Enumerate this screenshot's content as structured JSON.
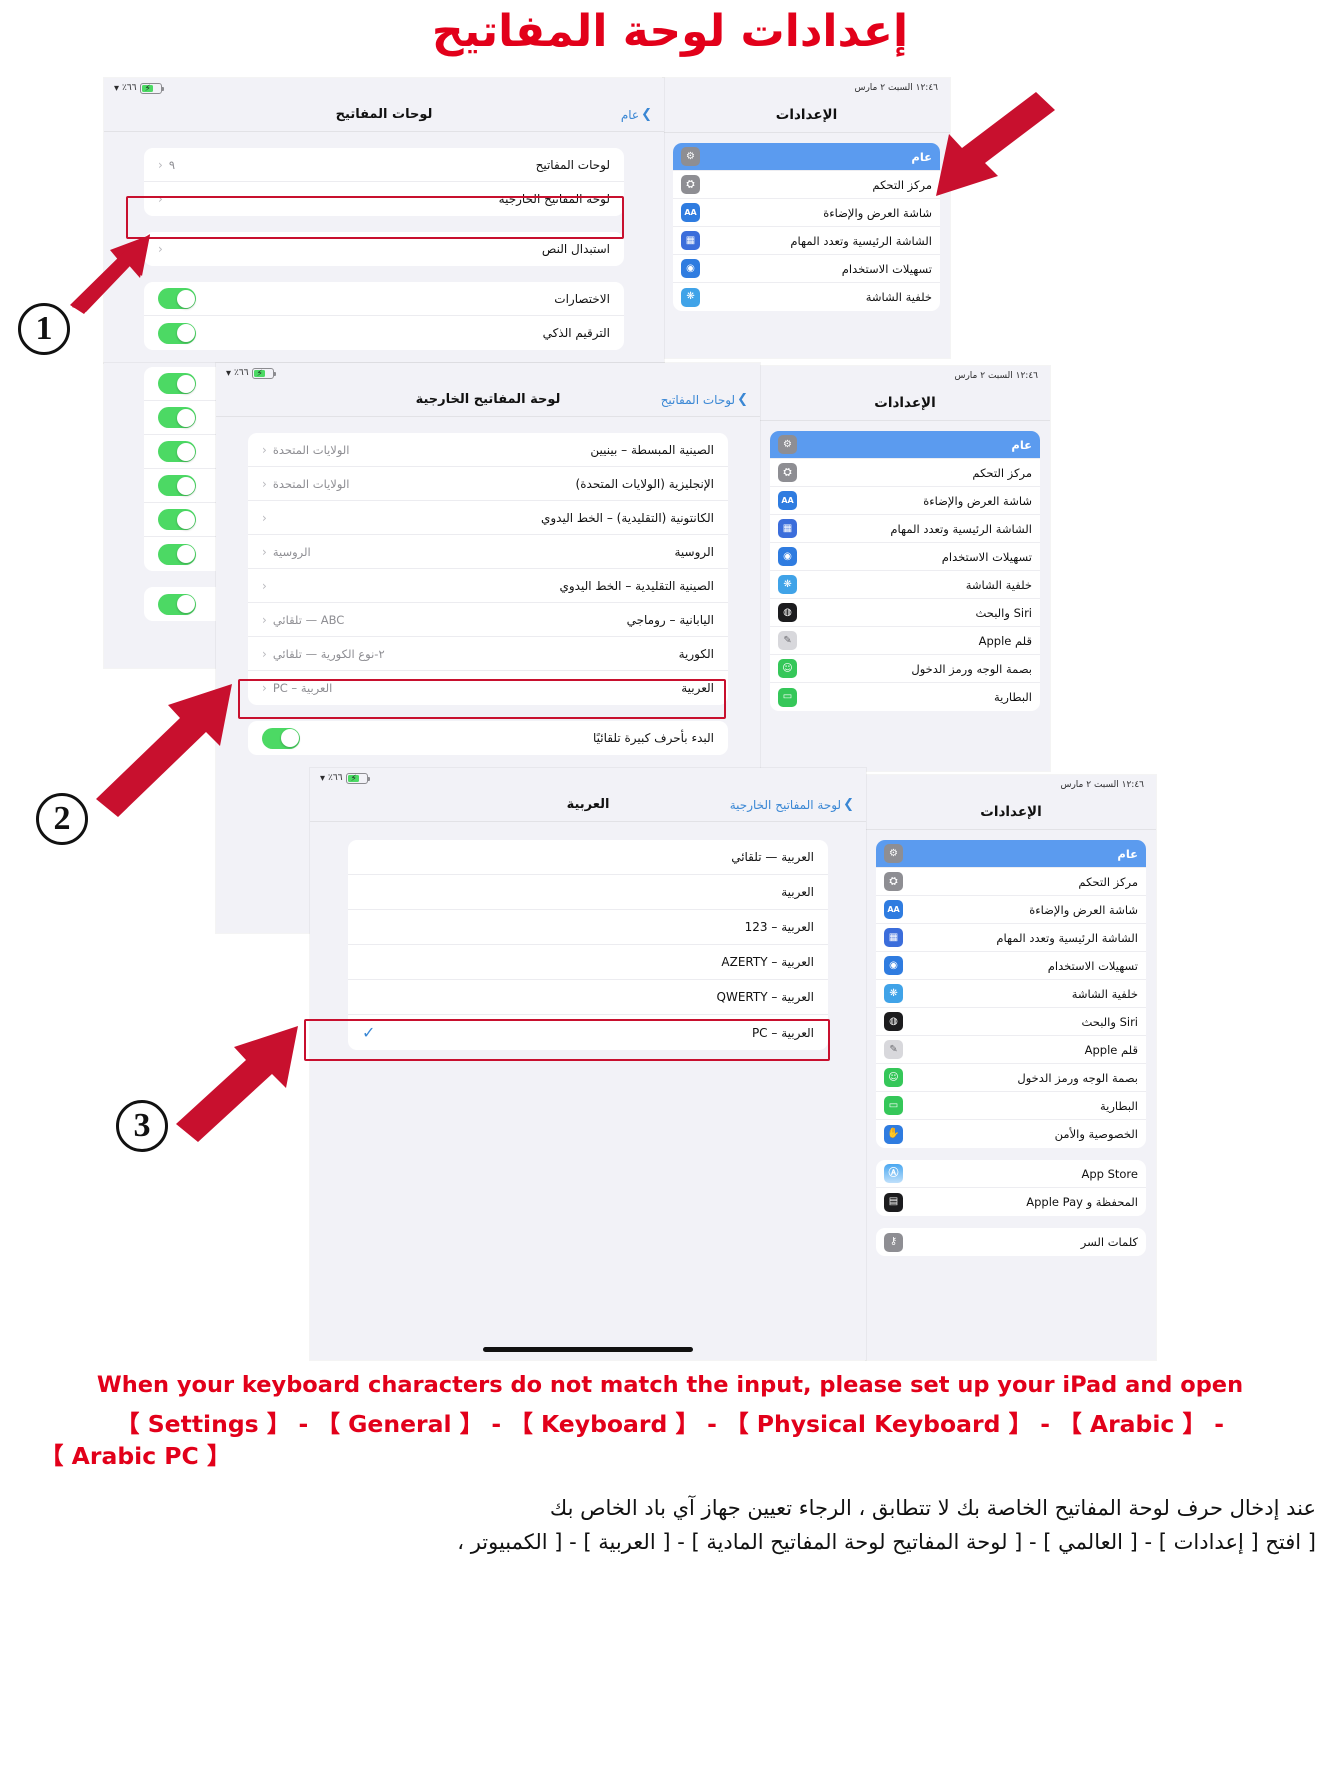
{
  "title": "إعدادات لوحة المفاتيح",
  "status_bar": {
    "battery_pct": "٦٦٪",
    "time_right": "١٢:٤٦   السبت ٢ مارس"
  },
  "panel1": {
    "nav_title": "لوحات المفاتيح",
    "back_label": "عام",
    "rows": [
      {
        "label": "لوحات المفاتيح",
        "value": "٩",
        "chevron": "‹"
      },
      {
        "label": "لوحة المفاتيح الخارجية",
        "value": "",
        "chevron": "‹"
      },
      {
        "label": "استبدال النص",
        "value": "",
        "chevron": "‹"
      }
    ],
    "toggles": [
      {
        "label": "الاختصارات",
        "on": true
      },
      {
        "label": "الترقيم الذكي",
        "on": true
      }
    ]
  },
  "panel2": {
    "nav_title": "لوحة المفاتيح الخارجية",
    "back_label": "لوحات المفاتيح",
    "rows": [
      {
        "label": "الصينية المبسطة – بينيين",
        "value": "الولايات المتحدة"
      },
      {
        "label": "الإنجليزية (الولايات المتحدة)",
        "value": "الولايات المتحدة"
      },
      {
        "label": "الكانتونية (التقليدية) – الخط اليدوي",
        "value": ""
      },
      {
        "label": "الروسية",
        "value": "الروسية"
      },
      {
        "label": "الصينية التقليدية – الخط اليدوي",
        "value": ""
      },
      {
        "label": "اليابانية – روماجي",
        "value": "ABC — تلقائي"
      },
      {
        "label": "الكورية",
        "value": "٢-نوع الكورية — تلقائي"
      },
      {
        "label": "العربية",
        "value": "العربية – PC"
      }
    ],
    "toggle_row": {
      "label": "البدء بأحرف كبيرة تلقائيًا",
      "on": true
    }
  },
  "panel3": {
    "nav_title": "العربية",
    "back_label": "لوحة المفاتيح الخارجية",
    "options": [
      {
        "label": "العربية — تلقائي",
        "checked": false
      },
      {
        "label": "العربية",
        "checked": false
      },
      {
        "label": "العربية – 123",
        "checked": false
      },
      {
        "label": "العربية – AZERTY",
        "checked": false
      },
      {
        "label": "العربية – QWERTY",
        "checked": false
      },
      {
        "label": "العربية – PC",
        "checked": true
      }
    ],
    "check_glyph": "✓"
  },
  "settings_sidebar": {
    "title": "الإعدادات",
    "items": [
      {
        "label": "عام",
        "icon": "gear-icon",
        "glyph": "⚙",
        "color": "#8e8e93",
        "selected": true
      },
      {
        "label": "مركز التحكم",
        "icon": "control-center-icon",
        "glyph": "⛭",
        "color": "#8e8e93",
        "selected": false
      },
      {
        "label": "شاشة العرض والإضاءة",
        "icon": "display-brightness-icon",
        "glyph": "AA",
        "color": "#2f7ce0",
        "selected": false
      },
      {
        "label": "الشاشة الرئيسية وتعدد المهام",
        "icon": "home-screen-icon",
        "glyph": "▦",
        "color": "#3b6ddb",
        "selected": false
      },
      {
        "label": "تسهيلات الاستخدام",
        "icon": "accessibility-icon",
        "glyph": "◉",
        "color": "#2f7ce0",
        "selected": false
      },
      {
        "label": "خلفية الشاشة",
        "icon": "wallpaper-icon",
        "glyph": "❋",
        "color": "#40a3e8",
        "selected": false
      },
      {
        "label": "Siri والبحث",
        "icon": "siri-icon",
        "glyph": "◍",
        "color": "#1c1c1e",
        "selected": false
      },
      {
        "label": "قلم Apple",
        "icon": "apple-pencil-icon",
        "glyph": "✎",
        "color": "#d8d8dc",
        "selected": false
      },
      {
        "label": "بصمة الوجه ورمز الدخول",
        "icon": "face-id-icon",
        "glyph": "☺",
        "color": "#35c759",
        "selected": false
      },
      {
        "label": "البطارية",
        "icon": "battery-icon",
        "glyph": "▭",
        "color": "#35c759",
        "selected": false
      },
      {
        "label": "الخصوصية والأمن",
        "icon": "privacy-hand-icon",
        "glyph": "✋",
        "color": "#2f7ce0",
        "selected": false
      }
    ],
    "group2": [
      {
        "label": "App Store",
        "icon": "app-store-icon",
        "glyph": "Ⓐ",
        "color": "#4aa8f0"
      },
      {
        "label": "المحفظة و Apple Pay",
        "icon": "wallet-icon",
        "glyph": "▤",
        "color": "#1c1c1e"
      }
    ],
    "group3": [
      {
        "label": "كلمات السر",
        "icon": "passwords-key-icon",
        "glyph": "🔑",
        "color": "#8e8e93"
      }
    ]
  },
  "steps": {
    "one": "1",
    "two": "2",
    "three": "3"
  },
  "caption_en_line1": "When your keyboard characters do not match the input, please set up your iPad and open",
  "caption_en_line2": "【 Settings 】 - 【 General 】 - 【 Keyboard 】 - 【 Physical Keyboard 】 - 【 Arabic 】 -",
  "caption_en_line3": "【 Arabic PC 】",
  "caption_ar_line1": "عند إدخال حرف لوحة المفاتيح الخاصة بك لا تتطابق ، الرجاء تعيين جهاز آي باد الخاص بك",
  "caption_ar_line2": "[ افتح [ إعدادات ] - [ العالمي ] - [ لوحة المفاتيح لوحة المفاتيح المادية ] - [ العربية ] - [ الكمبيوتر ،",
  "colors": {
    "accent_red": "#e2001a",
    "highlight_red": "#c8102e",
    "ios_blue": "#3a87d4",
    "toggle_green": "#4cd964",
    "selected_blue": "#5b9bef"
  }
}
